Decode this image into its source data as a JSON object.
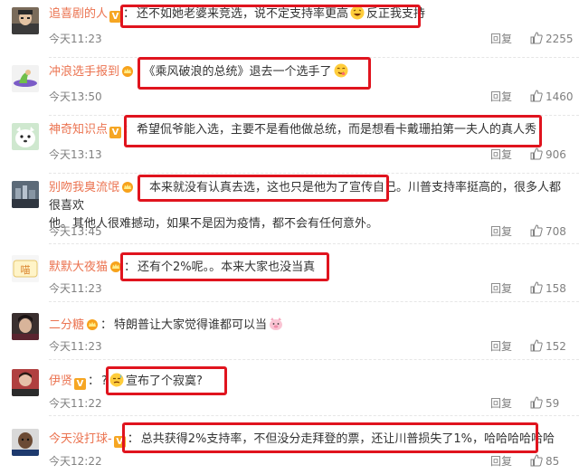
{
  "comments": [
    {
      "username": "追喜剧的人",
      "badge": "V",
      "text_a": "还不如她老婆来竞选，说不定支持率更高",
      "emoji1": "grin-emoji",
      "text_b": "反正我支持",
      "time": "今天11:23",
      "reply": "回复",
      "likes": "2255"
    },
    {
      "username": "冲浪选手报到",
      "badge": "crown",
      "text_a": "《乘风破浪的总统》退去一个选手了",
      "emoji1": "yum-emoji",
      "time": "今天13:50",
      "reply": "回复",
      "likes": "1460"
    },
    {
      "username": "神奇知识点",
      "badge": "V",
      "text_a": "希望侃爷能入选，主要不是看他做总统，而是想看卡戴珊拍第一夫人的真人秀",
      "time": "今天13:13",
      "reply": "回复",
      "likes": "906"
    },
    {
      "username": "别吻我臭流氓",
      "badge": "crown",
      "text_a": "本来就没有认真去选，这也只是他为了宣传自己。川普支持率挺高的，很多人都很喜欢",
      "text_line2": "他。其他人很难撼动，如果不是因为疫情，都不会有任何意外。",
      "time": "今天13:45",
      "reply": "回复",
      "likes": "708"
    },
    {
      "username": "默默大夜猫",
      "badge": "crown",
      "text_a": "还有个2%呢。。本来大家也没当真",
      "time": "今天11:23",
      "reply": "回复",
      "likes": "158"
    },
    {
      "username": "二分糖",
      "badge": "crown",
      "text_a": "特朗普让大家觉得谁都可以当",
      "emoji1": "pig-emoji",
      "time": "今天11:23",
      "reply": "回复",
      "likes": "152"
    },
    {
      "username": "伊贤",
      "badge": "V",
      "prefix": "?",
      "emoji1": "sweat-emoji",
      "text_b": "宣布了个寂寞?",
      "time": "今天11:22",
      "reply": "回复",
      "likes": "59"
    },
    {
      "username": "今天没打球-",
      "badge": "V",
      "text_a": "总共获得2%支持率，不但没分走拜登的票，还让川普损失了1%，哈哈哈哈哈哈",
      "time": "今天12:22",
      "reply": "回复",
      "likes": "85"
    }
  ],
  "colors": {
    "username": "#eb7350",
    "highlight_box": "#e0141e",
    "meta": "#808080"
  }
}
